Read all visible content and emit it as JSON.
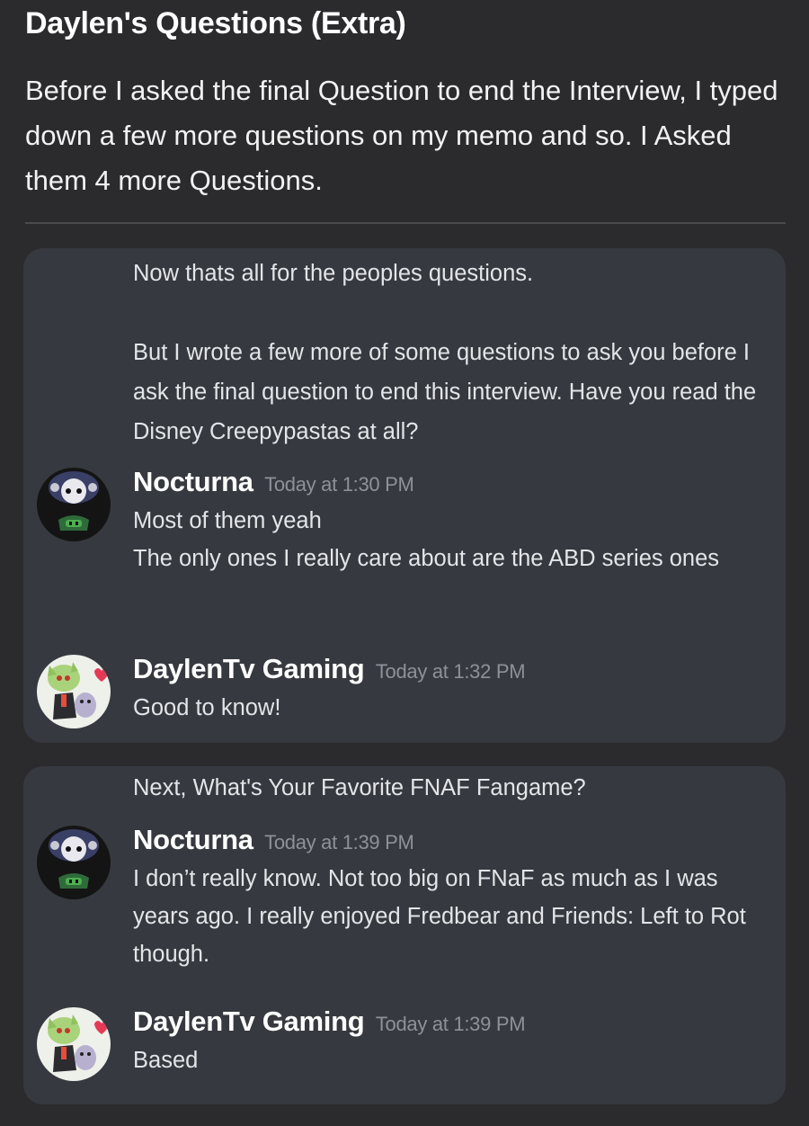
{
  "header": {
    "title": "Daylen's Questions (Extra)",
    "intro": "Before I asked the final Question to end the Interview, I typed down a few more questions on my memo and so. I Asked them 4 more Questions."
  },
  "cards": [
    {
      "prompt": "Now thats all for the peoples questions.\n\nBut I wrote a few more of some questions to ask you before I ask the final question to end this interview. Have you read the Disney Creepypastas at all?",
      "messages": [
        {
          "username": "Nocturna",
          "timestamp": "Today at 1:30 PM",
          "avatar_icon": "nocturna-avatar-icon",
          "lines": [
            "Most of them yeah",
            "The only ones I really care about are the ABD series ones"
          ]
        },
        {
          "username": "DaylenTv Gaming",
          "timestamp": "Today at 1:32 PM",
          "avatar_icon": "daylen-avatar-icon",
          "lines": [
            "Good to know!"
          ]
        }
      ]
    },
    {
      "prompt": "Next, What's Your Favorite FNAF Fangame?",
      "messages": [
        {
          "username": "Nocturna",
          "timestamp": "Today at 1:39 PM",
          "avatar_icon": "nocturna-avatar-icon",
          "lines": [
            "I don’t really know. Not too big on FNaF as much as I was years ago. I really enjoyed Fredbear and Friends: Left to Rot though."
          ]
        },
        {
          "username": "DaylenTv Gaming",
          "timestamp": "Today at 1:39 PM",
          "avatar_icon": "daylen-avatar-icon",
          "lines": [
            "Based"
          ]
        }
      ]
    }
  ],
  "colors": {
    "background": "#2b2a2c",
    "card": "#36393f",
    "text": "#e3e5e8",
    "timestamp": "#8e9297"
  }
}
